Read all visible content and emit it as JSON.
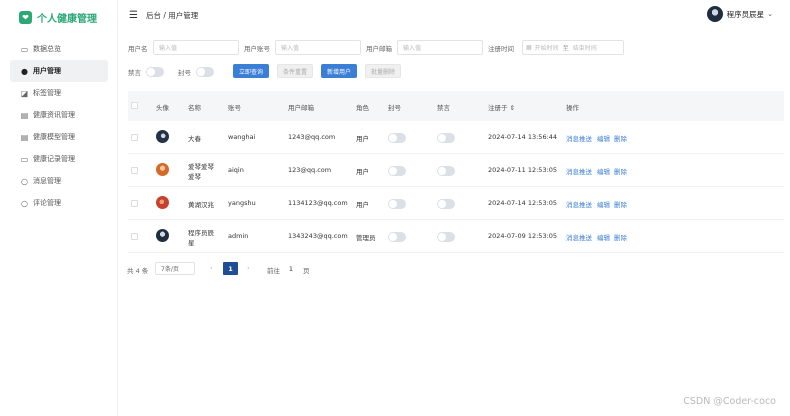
{
  "app": {
    "logo_glyph": "❤",
    "title": "个人健康管理",
    "accent_color": "#2aa876"
  },
  "sidebar": {
    "items": [
      {
        "label": "数据总览",
        "icon": "monitor-icon",
        "glyph": "▭",
        "active": false
      },
      {
        "label": "用户管理",
        "icon": "user-icon",
        "glyph": "●",
        "active": true
      },
      {
        "label": "标签管理",
        "icon": "bookmark-icon",
        "glyph": "◪",
        "active": false
      },
      {
        "label": "健康资讯管理",
        "icon": "document-icon",
        "glyph": "▤",
        "active": false
      },
      {
        "label": "健康模型管理",
        "icon": "document-icon",
        "glyph": "▤",
        "active": false
      },
      {
        "label": "健康记录管理",
        "icon": "screen-icon",
        "glyph": "▭",
        "active": false
      },
      {
        "label": "消息管理",
        "icon": "chat-icon",
        "glyph": "○",
        "active": false
      },
      {
        "label": "评论管理",
        "icon": "comment-icon",
        "glyph": "○",
        "active": false
      }
    ]
  },
  "header": {
    "menu_glyph": "☰",
    "breadcrumb": "后台 / 用户管理",
    "username": "程序员辰星",
    "caret": "⌄"
  },
  "filters": {
    "username_label": "用户名",
    "username_placeholder": "输入值",
    "account_label": "用户账号",
    "account_placeholder": "输入值",
    "email_label": "用户邮箱",
    "email_placeholder": "输入值",
    "register_label": "注册时间",
    "start_placeholder": "开始时间",
    "end_placeholder": "结束时间",
    "date_sep": "至",
    "mute_label": "禁言",
    "ban_label": "封号",
    "query_button": "立即查询",
    "reset_button": "条件重置",
    "add_button": "新增用户",
    "batch_delete_button": "批量删除"
  },
  "table": {
    "headers": {
      "avatar": "头像",
      "name": "名称",
      "account": "账号",
      "email": "用户邮箱",
      "role": "角色",
      "ban": "封号",
      "mute": "禁言",
      "registered": "注册于 ⇕",
      "actions": "操作"
    },
    "rows": [
      {
        "name": "大春",
        "name2": "",
        "account": "wanghai",
        "email": "1243@qq.com",
        "role": "用户",
        "registered": "2024-07-14 13:56:44",
        "avatar_color": "#243247"
      },
      {
        "name": "爱琴爱琴",
        "name2": "爱琴",
        "account": "aiqin",
        "email": "123@qq.com",
        "role": "用户",
        "registered": "2024-07-11 12:53:05",
        "avatar_color": "#d36a2a"
      },
      {
        "name": "黄湖汉兆",
        "name2": "",
        "account": "yangshu",
        "email": "1134123@qq.com",
        "role": "用户",
        "registered": "2024-07-14 12:53:05",
        "avatar_color": "#c8412f"
      },
      {
        "name": "程序员辰",
        "name2": "星",
        "account": "admin",
        "email": "1343243@qq.com",
        "role": "管理员",
        "registered": "2024-07-09 12:53:05",
        "avatar_color": "#1f2d3d"
      }
    ],
    "actions": {
      "message": "消息推送",
      "edit": "编辑",
      "delete": "删除"
    }
  },
  "pagination": {
    "total": "共 4 条",
    "page_size": "7条/页",
    "prev": "‹",
    "next": "›",
    "current": "1",
    "goto_label": "前往",
    "goto_value": "1",
    "page_unit": "页"
  },
  "watermark": "CSDN @Coder-coco"
}
